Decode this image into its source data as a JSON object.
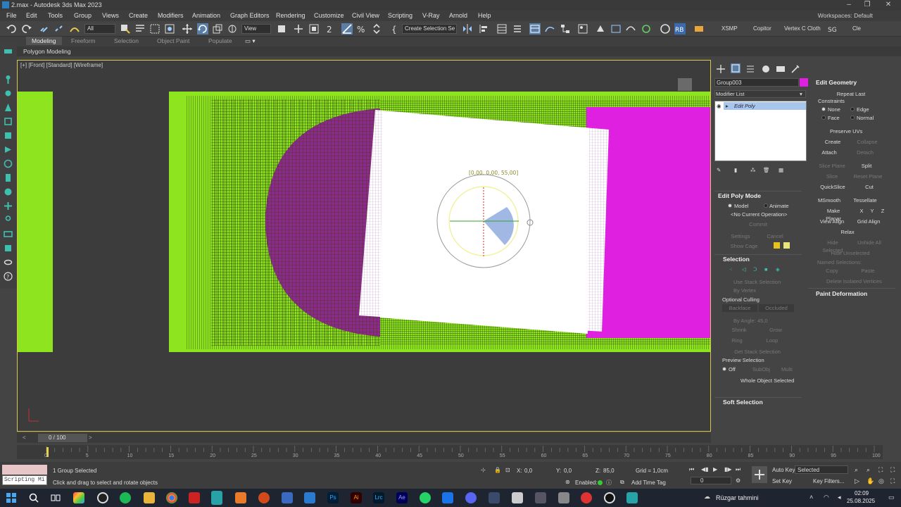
{
  "window": {
    "title": "2.max - Autodesk 3ds Max 2023"
  },
  "menu": [
    "File",
    "Edit",
    "Tools",
    "Group",
    "Views",
    "Create",
    "Modifiers",
    "Animation",
    "Graph Editors",
    "Rendering",
    "Customize",
    "Civil View",
    "Scripting",
    "V-Ray",
    "Arnold",
    "Help"
  ],
  "workspaces": "Workspaces: Default",
  "toolbar": {
    "filter": "All",
    "refcoord": "View",
    "selset": "Create Selection Se",
    "right_labels": [
      "XSMP",
      "Copitor",
      "Vertex C",
      "Cloth",
      "Cle"
    ]
  },
  "ribbon": {
    "tabs": [
      "Modeling",
      "Freeform",
      "Selection",
      "Object Paint",
      "Populate"
    ],
    "active": "Modeling",
    "sub": "Polygon Modeling"
  },
  "viewport": {
    "label": "[+] [Front] [Standard] [Wireframe]",
    "gizmo_readout": "[0,00, 0,00, 55,00]"
  },
  "command_panel": {
    "object_name": "Group003",
    "object_color": "#e020e0",
    "modifier_list": "Modifier List",
    "stack": [
      "Edit Poly"
    ],
    "edit_poly_mode": {
      "title": "Edit Poly Mode",
      "model": "Model",
      "animate": "Animate",
      "op": "<No Current Operation>",
      "commit": "Commit",
      "settings": "Settings",
      "cancel": "Cancel",
      "show_cage": "Show Cage"
    },
    "selection": {
      "title": "Selection",
      "use_stack": "Use Stack Selection",
      "by_vertex": "By Vertex",
      "opt_culling": "Optional Culling",
      "backface": "Backface",
      "occluded": "Occluded",
      "by_angle": "By Angle:",
      "angle_val": "45,0",
      "shrink": "Shrink",
      "grow": "Grow",
      "ring": "Ring",
      "loop": "Loop",
      "get_stack": "Get Stack Selection",
      "preview": "Preview Selection",
      "off": "Off",
      "subobj": "SubObj",
      "multi": "Multi",
      "whole": "Whole Object Selected"
    },
    "soft_selection": "Soft Selection",
    "edit_geometry": {
      "title": "Edit Geometry",
      "repeat": "Repeat Last",
      "constraints": "Constraints",
      "none": "None",
      "edge": "Edge",
      "face": "Face",
      "normal": "Normal",
      "preserve_uvs": "Preserve UVs",
      "create": "Create",
      "collapse": "Collapse",
      "attach": "Attach",
      "detach": "Detach",
      "slice_plane": "Slice Plane",
      "split": "Split",
      "slice": "Slice",
      "reset_plane": "Reset Plane",
      "quickslice": "QuickSlice",
      "cut": "Cut",
      "msmooth": "MSmooth",
      "tessellate": "Tessellate",
      "make_planar": "Make Planar",
      "x": "X",
      "y": "Y",
      "z": "Z",
      "view_align": "View Align",
      "grid_align": "Grid Align",
      "relax": "Relax",
      "hide_selected": "Hide Selected",
      "unhide_all": "Unhide All",
      "hide_unselected": "Hide Unselected",
      "named_sel": "Named Selections:",
      "copy": "Copy",
      "paste": "Paste",
      "delete_iso": "Delete Isolated Vertices"
    },
    "paint_deformation": "Paint Deformation"
  },
  "timeline": {
    "frame": "0 / 100",
    "ticks": [
      "0",
      "5",
      "10",
      "15",
      "20",
      "25",
      "30",
      "35",
      "40",
      "45",
      "50",
      "55",
      "60",
      "65",
      "70",
      "75",
      "80",
      "85",
      "90",
      "95",
      "100"
    ]
  },
  "status": {
    "script": "Scripting Mi",
    "selected": "1 Group Selected",
    "prompt": "Click and drag to select and rotate objects",
    "x_label": "X:",
    "x": "0,0",
    "y_label": "Y:",
    "y": "0,0",
    "z_label": "Z:",
    "z": "85,0",
    "grid": "Grid = 1,0cm",
    "enabled": "Enabled:",
    "add_time_tag": "Add Time Tag",
    "auto_key": "Auto Key",
    "set_key": "Set Key",
    "key_mode": "Selected",
    "key_filters": "Key Filters...",
    "frame_field": "0"
  },
  "taskbar": {
    "weather": "Rüzgar tahmini",
    "time": "02:09",
    "date": "25.08.2025"
  }
}
